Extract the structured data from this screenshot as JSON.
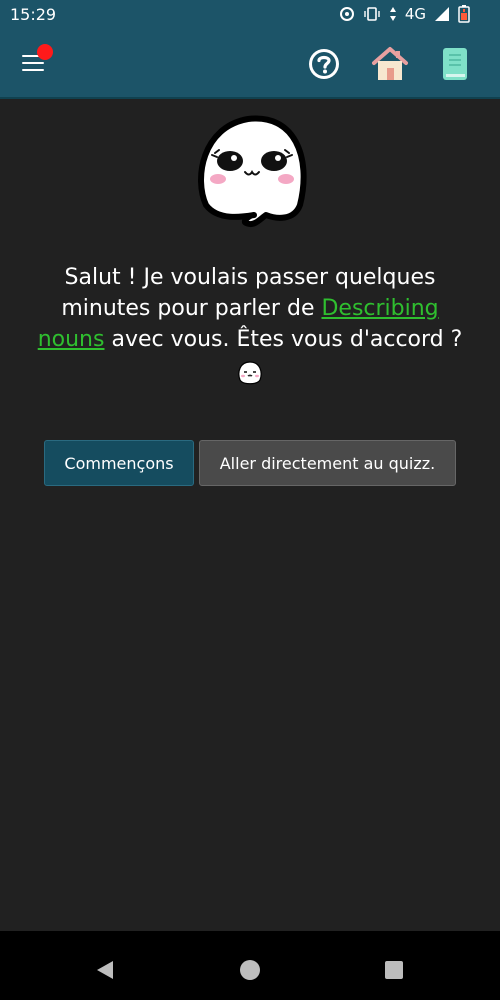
{
  "status_bar": {
    "time": "15:29",
    "network": "4G",
    "icons": [
      "sync-icon",
      "vibrate-icon",
      "data-arrows-icon",
      "signal-icon",
      "battery-icon"
    ]
  },
  "app_bar": {
    "icons": [
      "menu-icon",
      "help-icon",
      "home-icon",
      "book-icon"
    ],
    "has_notification": true,
    "colors": {
      "background": "#1c5468",
      "notification": "#ff1a1a"
    }
  },
  "main": {
    "message_before": "Salut ! Je voulais passer quelques minutes pour parler de ",
    "topic_link": "Describing nouns",
    "message_after": " avec vous. Êtes vous d'accord ?",
    "buttons": {
      "start": "Commençons",
      "quiz": "Aller directement au quizz."
    },
    "colors": {
      "background": "#212121",
      "link": "#2fbf2f"
    }
  },
  "nav_bar": {
    "icons": [
      "back-icon",
      "home-circle-icon",
      "recent-apps-icon"
    ]
  }
}
